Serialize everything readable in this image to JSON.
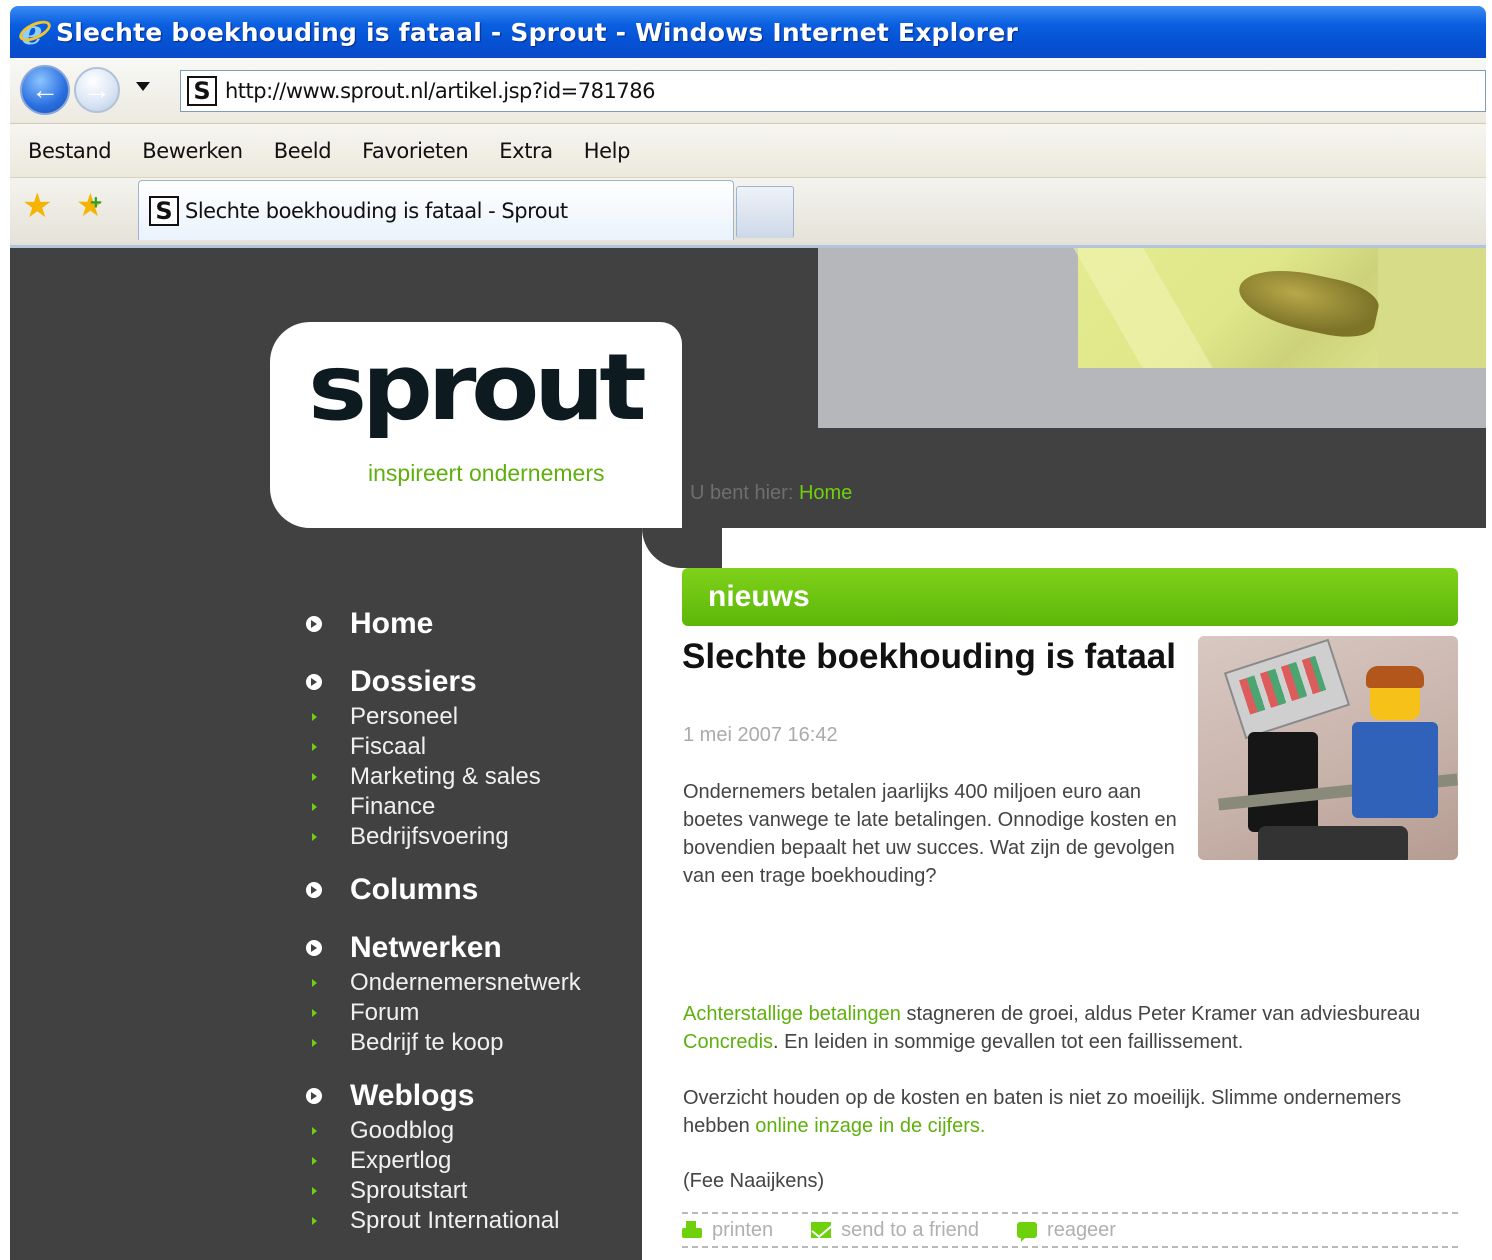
{
  "window": {
    "title": "Slechte boekhouding is fataal - Sprout - Windows Internet Explorer"
  },
  "address": {
    "url": "http://www.sprout.nl/artikel.jsp?id=781786",
    "favicon_letter": "S"
  },
  "menu": {
    "items": [
      "Bestand",
      "Bewerken",
      "Beeld",
      "Favorieten",
      "Extra",
      "Help"
    ]
  },
  "tabs": {
    "active_title": "Slechte boekhouding is fataal - Sprout"
  },
  "site": {
    "logo": "sprout",
    "tagline": "inspireert ondernemers"
  },
  "breadcrumb": {
    "prefix": "U bent hier:",
    "current": "Home"
  },
  "nav": {
    "home": "Home",
    "dossiers": "Dossiers",
    "dossiers_items": [
      "Personeel",
      "Fiscaal",
      "Marketing & sales",
      "Finance",
      "Bedrijfsvoering"
    ],
    "columns": "Columns",
    "netwerken": "Netwerken",
    "netwerken_items": [
      "Ondernemersnetwerk",
      "Forum",
      "Bedrijf te koop"
    ],
    "weblogs": "Weblogs",
    "weblogs_items": [
      "Goodblog",
      "Expertlog",
      "Sproutstart",
      "Sprout International"
    ]
  },
  "article": {
    "section": "nieuws",
    "title": "Slechte boekhouding is fataal",
    "date": "1 mei 2007 16:42",
    "intro": "Ondernemers betalen jaarlijks 400 miljoen euro aan boetes vanwege te late betalingen. Onnodige kosten en bovendien bepaalt het uw succes. Wat zijn de gevolgen van een trage boekhouding?",
    "p1_link1": "Achterstallige betalingen",
    "p1_text1": " stagneren de groei, aldus Peter Kramer van adviesbureau ",
    "p1_link2": "Concredis",
    "p1_text2": ". En leiden in sommige gevallen tot een faillissement.",
    "p2_text": "Overzicht houden op de kosten en baten is niet zo moeilijk. Slimme ondernemers hebben ",
    "p2_link": "online inzage in de cijfers",
    "p2_end": ".",
    "author": "(Fee Naaijkens)"
  },
  "actions": {
    "print": "printen",
    "send": "send to a friend",
    "comment": "reageer"
  }
}
